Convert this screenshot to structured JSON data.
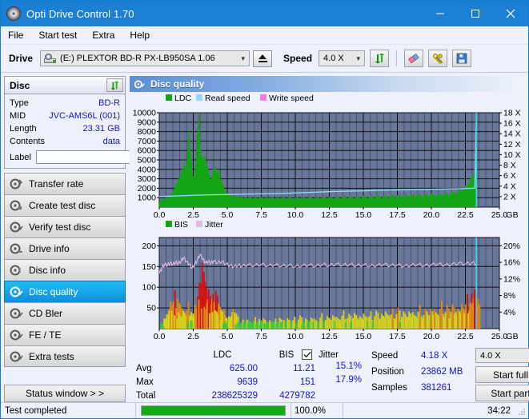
{
  "window": {
    "title": "Opti Drive Control 1.70",
    "icon": "disc-icon",
    "minimize": "minimize-icon",
    "maximize": "maximize-icon",
    "close": "close-icon"
  },
  "menu": {
    "items": [
      {
        "label": "File"
      },
      {
        "label": "Start test"
      },
      {
        "label": "Extra"
      },
      {
        "label": "Help"
      }
    ]
  },
  "toolbar": {
    "drive_label": "Drive",
    "drive_value": "(E:)  PLEXTOR BD-R  PX-LB950SA 1.06",
    "eject": "eject-icon",
    "speed_label": "Speed",
    "speed_value": "4.0 X",
    "refresh_icon": "refresh-arrows-icon",
    "erase_icon": "eraser-icon",
    "tools_icon": "tools-icon",
    "save_icon": "save-floppy-icon"
  },
  "disc_panel": {
    "title": "Disc",
    "refresh_icon": "refresh-arrows-icon",
    "rows": [
      {
        "key": "Type",
        "value": "BD-R"
      },
      {
        "key": "MID",
        "value": "JVC-AMS6L (001)"
      },
      {
        "key": "Length",
        "value": "23.31 GB"
      },
      {
        "key": "Contents",
        "value": "data"
      }
    ],
    "label_key": "Label",
    "label_value": "",
    "label_placeholder": "",
    "label_button_icon": "cd-icon"
  },
  "sidebar": {
    "items": [
      {
        "label": "Transfer rate",
        "icon": "disc-transfer-icon",
        "active": false
      },
      {
        "label": "Create test disc",
        "icon": "disc-create-icon",
        "active": false
      },
      {
        "label": "Verify test disc",
        "icon": "disc-verify-icon",
        "active": false
      },
      {
        "label": "Drive info",
        "icon": "disc-drive-icon",
        "active": false
      },
      {
        "label": "Disc info",
        "icon": "disc-info-icon",
        "active": false
      },
      {
        "label": "Disc quality",
        "icon": "disc-quality-icon",
        "active": true
      },
      {
        "label": "CD Bler",
        "icon": "disc-bler-icon",
        "active": false
      },
      {
        "label": "FE / TE",
        "icon": "disc-fete-icon",
        "active": false
      },
      {
        "label": "Extra tests",
        "icon": "disc-extra-icon",
        "active": false
      }
    ],
    "status_window": "Status window > >"
  },
  "panel": {
    "title": "Disc quality",
    "icon": "disc-quality-icon"
  },
  "stats": {
    "header": {
      "ldc": "LDC",
      "bis": "BIS",
      "jitter": "Jitter"
    },
    "jitter_checked": true,
    "rows": [
      {
        "label": "Avg",
        "ldc": "625.00",
        "bis": "11.21",
        "jitter": "15.1%"
      },
      {
        "label": "Max",
        "ldc": "9639",
        "bis": "151",
        "jitter": "17.9%"
      },
      {
        "label": "Total",
        "ldc": "238625329",
        "bis": "4279782",
        "jitter": ""
      }
    ]
  },
  "controls": {
    "speed_label": "Speed",
    "speed_value": "4.18 X",
    "speed_select": "4.0 X",
    "position_label": "Position",
    "position_value": "23862 MB",
    "samples_label": "Samples",
    "samples_value": "381261",
    "start_full": "Start full",
    "start_part": "Start part"
  },
  "statusbar": {
    "message": "Test completed",
    "progress": 100.0,
    "progress_text": "100.0%",
    "elapsed": "34:22"
  },
  "chart_data": [
    {
      "type": "area",
      "title": "LDC",
      "xlabel": "GB",
      "ylabel": "LDC",
      "xlim": [
        0.0,
        25.0
      ],
      "ylim": [
        0,
        10000
      ],
      "xticks": [
        "0.0",
        "2.5",
        "5.0",
        "7.5",
        "10.0",
        "12.5",
        "15.0",
        "17.5",
        "20.0",
        "22.5",
        "25.0"
      ],
      "xunit": "GB",
      "yticks": [
        "10000",
        "9000",
        "8000",
        "7000",
        "6000",
        "5000",
        "4000",
        "3000",
        "2000",
        "1000"
      ],
      "y2ticks": [
        "18 X",
        "16 X",
        "14 X",
        "12 X",
        "10 X",
        "8 X",
        "6 X",
        "4 X",
        "2 X"
      ],
      "y2lim": [
        0,
        18
      ],
      "grid": true,
      "plot_bg": "#69779b",
      "legend_position": "top-left",
      "legend": [
        {
          "name": "LDC",
          "color": "#13a513"
        },
        {
          "name": "Read speed",
          "color": "#8fd8f2"
        },
        {
          "name": "Write speed",
          "color": "#f47ddd"
        }
      ],
      "end_marker_x": 23.31,
      "end_marker_color": "#35d7ef",
      "series": [
        {
          "name": "LDC",
          "color": "#13a513",
          "kind": "area",
          "x": [
            0.0,
            0.15,
            0.3,
            0.45,
            0.6,
            0.8,
            1.0,
            1.2,
            1.4,
            1.6,
            1.8,
            2.0,
            2.15,
            2.3,
            2.45,
            2.6,
            2.75,
            2.9,
            3.05,
            3.2,
            3.35,
            3.5,
            3.65,
            3.8,
            3.95,
            4.1,
            4.25,
            4.4,
            4.55,
            4.7,
            4.85,
            5.0,
            5.2,
            5.4,
            5.6,
            5.8,
            6.0,
            6.3,
            6.6,
            7.0,
            7.4,
            7.8,
            8.2,
            8.6,
            9.0,
            9.5,
            10.0,
            10.5,
            11.0,
            11.5,
            12.0,
            12.5,
            13.0,
            13.5,
            14.0,
            14.5,
            15.0,
            15.5,
            16.0,
            16.5,
            17.0,
            17.5,
            18.0,
            18.5,
            19.0,
            19.5,
            20.0,
            20.5,
            21.0,
            21.5,
            22.0,
            22.4,
            22.7,
            22.9,
            23.1,
            23.25,
            23.31
          ],
          "y": [
            300,
            620,
            700,
            780,
            900,
            1100,
            1400,
            2100,
            2600,
            3300,
            4200,
            4000,
            7800,
            5200,
            3100,
            2700,
            6200,
            9639,
            5400,
            4800,
            5200,
            4100,
            3300,
            2400,
            3600,
            4000,
            3400,
            3700,
            2500,
            2000,
            1500,
            1200,
            1100,
            1050,
            1000,
            980,
            950,
            900,
            930,
            880,
            900,
            860,
            880,
            850,
            870,
            900,
            860,
            880,
            900,
            880,
            920,
            900,
            930,
            950,
            980,
            950,
            1000,
            980,
            1050,
            1000,
            1100,
            1050,
            1150,
            1100,
            1200,
            1150,
            1250,
            1200,
            1300,
            1350,
            1500,
            1800,
            2200,
            2800,
            3200,
            3500,
            3400
          ]
        },
        {
          "name": "Read speed",
          "color": "#8fd8f2",
          "kind": "line",
          "axis": "y2",
          "x": [
            0.0,
            1.0,
            2.0,
            3.0,
            4.0,
            5.0,
            6.0,
            7.0,
            8.0,
            9.0,
            10.0,
            11.0,
            12.0,
            13.0,
            14.0,
            15.0,
            16.0,
            17.0,
            18.0,
            19.0,
            20.0,
            21.0,
            22.0,
            22.5,
            23.0,
            23.2,
            23.25,
            23.3,
            23.31
          ],
          "y": [
            2.0,
            2.1,
            2.2,
            2.3,
            2.35,
            2.4,
            2.45,
            2.5,
            2.55,
            2.6,
            2.7,
            2.8,
            2.9,
            3.0,
            3.05,
            3.1,
            3.2,
            3.25,
            3.3,
            3.35,
            3.4,
            3.45,
            3.5,
            3.55,
            3.6,
            3.65,
            10.0,
            16.5,
            18.0
          ]
        }
      ]
    },
    {
      "type": "bar",
      "title": "BIS",
      "xlabel": "GB",
      "ylabel": "BIS",
      "xlim": [
        0.0,
        25.0
      ],
      "ylim": [
        0,
        220
      ],
      "xticks": [
        "0.0",
        "2.5",
        "5.0",
        "7.5",
        "10.0",
        "12.5",
        "15.0",
        "17.5",
        "20.0",
        "22.5",
        "25.0"
      ],
      "xunit": "GB",
      "yticks": [
        "200",
        "150",
        "100",
        "50"
      ],
      "y2ticks": [
        "20%",
        "16%",
        "12%",
        "8%",
        "4%"
      ],
      "y2lim": [
        0,
        22
      ],
      "grid": true,
      "plot_bg": "#69779b",
      "legend_position": "top-left",
      "legend": [
        {
          "name": "BIS",
          "color": "#13a513"
        },
        {
          "name": "Jitter",
          "color": "#e3b8e3"
        }
      ],
      "end_marker_x": 23.31,
      "end_marker_color": "#35d7ef",
      "series": [
        {
          "name": "BIS",
          "color_scale": [
            {
              "max": 20,
              "color": "#3fc73f"
            },
            {
              "max": 45,
              "color": "#d2d21e"
            },
            {
              "max": 75,
              "color": "#e08a14"
            },
            {
              "max": 999,
              "color": "#d21010"
            }
          ],
          "kind": "bar",
          "x": [
            0.1,
            0.3,
            0.5,
            0.7,
            0.9,
            1.1,
            1.3,
            1.5,
            1.7,
            1.9,
            2.1,
            2.3,
            2.5,
            2.7,
            2.9,
            3.1,
            3.3,
            3.5,
            3.7,
            3.9,
            4.1,
            4.3,
            4.5,
            4.7,
            4.9,
            5.1,
            5.3,
            5.5,
            5.8,
            6.1,
            6.4,
            6.7,
            7.0,
            7.3,
            7.6,
            7.9,
            8.2,
            8.5,
            8.8,
            9.1,
            9.5,
            9.9,
            10.3,
            10.7,
            11.1,
            11.5,
            11.9,
            12.3,
            12.7,
            13.1,
            13.5,
            13.9,
            14.3,
            14.7,
            15.1,
            15.5,
            15.9,
            16.3,
            16.7,
            17.1,
            17.5,
            17.9,
            18.3,
            18.7,
            19.1,
            19.5,
            19.9,
            20.3,
            20.7,
            21.1,
            21.5,
            21.9,
            22.3,
            22.6,
            22.9,
            23.1,
            23.25
          ],
          "y": [
            18,
            22,
            35,
            55,
            72,
            80,
            68,
            60,
            52,
            45,
            58,
            40,
            30,
            62,
            95,
            151,
            120,
            85,
            110,
            75,
            92,
            68,
            58,
            40,
            25,
            30,
            48,
            55,
            18,
            22,
            25,
            20,
            24,
            22,
            26,
            20,
            24,
            22,
            26,
            24,
            28,
            25,
            30,
            26,
            32,
            28,
            34,
            30,
            36,
            32,
            38,
            34,
            40,
            36,
            42,
            38,
            44,
            40,
            46,
            42,
            48,
            44,
            50,
            46,
            52,
            48,
            54,
            50,
            58,
            54,
            62,
            58,
            70,
            75,
            85,
            95,
            105
          ]
        },
        {
          "name": "Jitter",
          "color": "#e3b8e3",
          "kind": "line",
          "axis": "y2",
          "x": [
            0.0,
            0.2,
            0.4,
            0.6,
            0.8,
            1.0,
            1.2,
            1.4,
            1.6,
            1.8,
            2.0,
            2.2,
            2.4,
            2.6,
            2.8,
            3.0,
            3.2,
            3.4,
            3.6,
            3.8,
            4.0,
            4.3,
            4.6,
            4.9,
            5.2,
            5.5,
            5.8,
            6.1,
            6.5,
            7.0,
            7.5,
            8.0,
            8.5,
            9.0,
            9.5,
            10.0,
            10.5,
            11.0,
            11.5,
            12.0,
            12.5,
            13.0,
            13.5,
            14.0,
            14.5,
            15.0,
            15.5,
            16.0,
            16.5,
            17.0,
            17.5,
            18.0,
            18.5,
            19.0,
            19.5,
            20.0,
            20.5,
            21.0,
            21.5,
            22.0,
            22.5,
            23.0,
            23.31
          ],
          "y": [
            13.3,
            14.8,
            15.5,
            15.3,
            15.8,
            15.5,
            16.0,
            15.7,
            16.3,
            17.2,
            16.1,
            15.6,
            14.6,
            15.4,
            16.6,
            17.9,
            16.8,
            15.9,
            16.2,
            15.8,
            16.3,
            15.9,
            16.2,
            15.6,
            15.2,
            15.0,
            15.3,
            15.1,
            15.4,
            15.2,
            15.5,
            15.2,
            15.4,
            15.1,
            15.3,
            15.0,
            15.2,
            15.4,
            15.1,
            15.5,
            15.2,
            15.6,
            15.3,
            15.5,
            15.2,
            15.4,
            15.1,
            15.3,
            15.5,
            15.2,
            15.4,
            15.1,
            15.3,
            15.5,
            15.2,
            15.4,
            15.6,
            15.3,
            15.5,
            15.8,
            15.6,
            15.9,
            15.7
          ]
        }
      ]
    }
  ]
}
